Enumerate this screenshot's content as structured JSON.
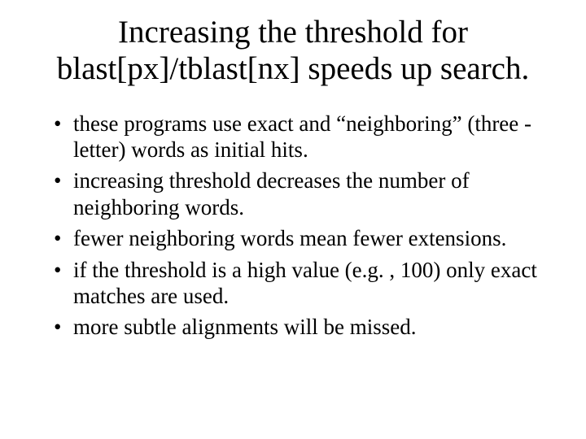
{
  "title": "Increasing the threshold for blast[px]/tblast[nx] speeds up search.",
  "bullets": [
    "these programs use exact and “neighboring” (three -letter) words as initial hits.",
    "increasing threshold decreases the number of neighboring words.",
    "fewer neighboring words mean fewer extensions.",
    "if the threshold is a high value (e.g. , 100) only exact matches are used.",
    "more subtle alignments will be missed."
  ]
}
